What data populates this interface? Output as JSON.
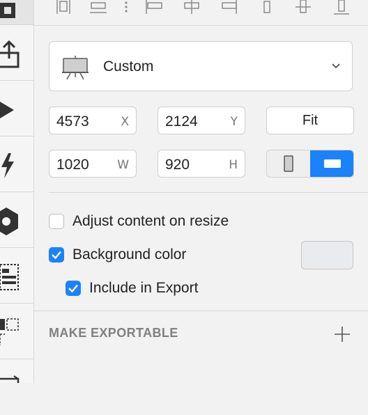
{
  "preset": {
    "label": "Custom"
  },
  "geometry": {
    "x": {
      "value": "4573",
      "unit": "X"
    },
    "y": {
      "value": "2124",
      "unit": "Y"
    },
    "w": {
      "value": "1020",
      "unit": "W"
    },
    "h": {
      "value": "920",
      "unit": "H"
    },
    "fit_label": "Fit",
    "orientation": "landscape"
  },
  "options": {
    "adjust_content": {
      "label": "Adjust content on resize",
      "checked": false
    },
    "background_color": {
      "label": "Background color",
      "checked": true,
      "color": "#e8ecef"
    },
    "include_in_export": {
      "label": "Include in Export",
      "checked": true
    }
  },
  "export_section": {
    "title": "MAKE EXPORTABLE"
  },
  "colors": {
    "accent": "#1a82fb"
  },
  "icons": {
    "rail": [
      "slice-icon",
      "upload-icon",
      "play-icon",
      "lightning-icon",
      "hexagon-icon",
      "layout-icon",
      "group-icon",
      "frame-icon"
    ],
    "align": [
      "distribute-icon",
      "align-left-icon",
      "align-horizontal-center-icon",
      "align-right-icon",
      "align-top-icon",
      "align-vertical-center-icon",
      "align-bottom-icon"
    ],
    "preset": "easel-icon",
    "dropdown": "chevron-down-icon",
    "add": "plus-icon"
  }
}
